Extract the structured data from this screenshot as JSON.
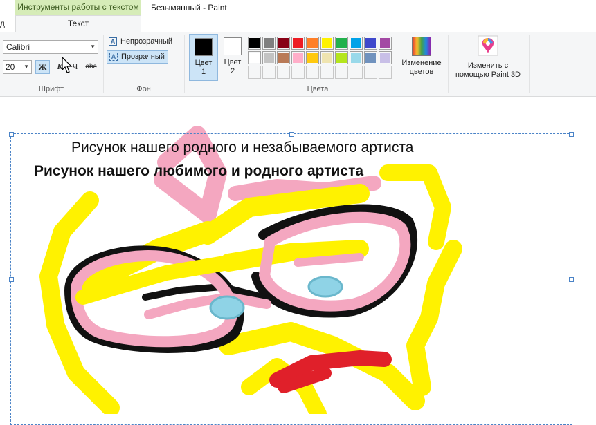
{
  "title_bar": {
    "context_tab": "Инструменты работы с текстом",
    "document_title": "Безымянный - Paint"
  },
  "tabs": {
    "cut_label": "д",
    "active": "Текст"
  },
  "font_group": {
    "font_name": "Calibri",
    "font_size": "20",
    "bold": "Ж",
    "italic": "К",
    "underline": "Ч",
    "strike": "abc",
    "label": "Шрифт"
  },
  "background_group": {
    "opaque": "Непрозрачный",
    "transparent": "Прозрачный",
    "label": "Фон"
  },
  "colors_group": {
    "color1_line1": "Цвет",
    "color1_line2": "1",
    "color1_value": "#000000",
    "color2_line1": "Цвет",
    "color2_line2": "2",
    "color2_value": "#ffffff",
    "edit_colors_line1": "Изменение",
    "edit_colors_line2": "цветов",
    "label": "Цвета",
    "palette_row1": [
      "#000000",
      "#7f7f7f",
      "#880015",
      "#ed1c24",
      "#ff7f27",
      "#fff200",
      "#22b14c",
      "#00a2e8",
      "#3f48cc",
      "#a349a4"
    ],
    "palette_row2": [
      "#ffffff",
      "#c3c3c3",
      "#b97a57",
      "#ffaec9",
      "#ffc90e",
      "#efe4b0",
      "#b5e61d",
      "#99d9ea",
      "#7092be",
      "#c8bfe7"
    ]
  },
  "paint3d": {
    "line1": "Изменить с",
    "line2": "помощью Paint 3D"
  },
  "canvas": {
    "text_line1": "Рисунок нашего родного и незабываемого артиста",
    "text_line2": "Рисунок нашего любимого и родного артиста",
    "colors": {
      "yellow": "#fff200",
      "pink": "#f4a7c0",
      "black": "#111111",
      "blue": "#8fd3e6",
      "red": "#e0202a"
    }
  }
}
